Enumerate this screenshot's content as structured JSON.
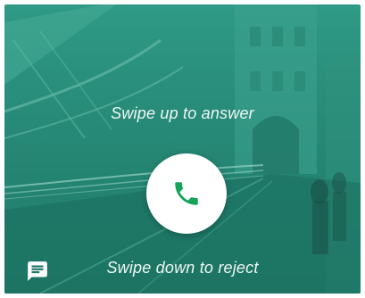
{
  "incoming_call": {
    "swipe_up_hint": "Swipe up to answer",
    "swipe_down_hint": "Swipe down to reject",
    "answer_icon": "phone-icon",
    "message_icon": "message-icon"
  },
  "colors": {
    "overlay": "#2a9480",
    "answer_icon": "#16a35a",
    "hint_text": "#eef8f5"
  }
}
